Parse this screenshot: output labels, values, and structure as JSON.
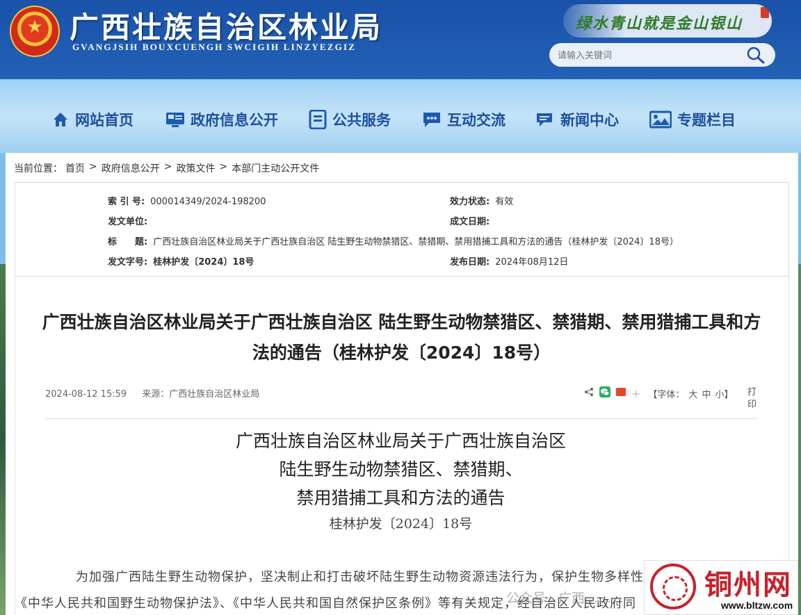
{
  "header": {
    "title": "广西壮族自治区林业局",
    "subtitle": "GVANGJSIH BOUXCUENGH SWCIGIH LINZYEZGIZ",
    "slogan": "绿水青山就是金山银山",
    "search_placeholder": "请输入关键词"
  },
  "nav": [
    {
      "label": "网站首页",
      "icon": "home-icon"
    },
    {
      "label": "政府信息公开",
      "icon": "monitor-icon"
    },
    {
      "label": "公共服务",
      "icon": "document-icon"
    },
    {
      "label": "互动交流",
      "icon": "chat-icon"
    },
    {
      "label": "新闻中心",
      "icon": "news-icon"
    },
    {
      "label": "专题栏目",
      "icon": "image-icon"
    }
  ],
  "breadcrumb": {
    "prefix": "当前位置：",
    "items": [
      "首页",
      "政府信息公开",
      "政策文件",
      "本部门主动公开文件"
    ]
  },
  "info": {
    "index_label": "索 引 号:",
    "index_value": "000014349/2024-198200",
    "status_label": "效力状态:",
    "status_value": "有效",
    "issuer_label": "发文单位:",
    "issuer_value": "",
    "created_label": "成文日期:",
    "created_value": "",
    "title_label": "标　　题:",
    "title_value": "广西壮族自治区林业局关于广西壮族自治区 陆生野生动物禁猎区、禁猎期、禁用猎捕工具和方法的通告（桂林护发〔2024〕18号）",
    "docno_label": "发文字号:",
    "docno_value": "桂林护发〔2024〕18号",
    "pubdate_label": "发布日期:",
    "pubdate_value": "2024年08月12日"
  },
  "article": {
    "title": "广西壮族自治区林业局关于广西壮族自治区 陆生野生动物禁猎区、禁猎期、禁用猎捕工具和方法的通告（桂林护发〔2024〕18号）",
    "datetime": "2024-08-12 15:59",
    "source": "来源：广西壮族自治区林业局",
    "font_label": "【字体：",
    "font_big": "大",
    "font_mid": "中",
    "font_small": "小】",
    "print": "打印",
    "doc_title_1": "广西壮族自治区林业局关于广西壮族自治区",
    "doc_title_2": "陆生野生动物禁猎区、禁猎期、",
    "doc_title_3": "禁用猎捕工具和方法的通告",
    "doc_num": "桂林护发〔2024〕18号",
    "body_1": "为加强广西陆生野生动物保护，坚决制止和打击破坏陆生野生动物资源违法行为，保护生物多样性，根据",
    "body_2": "《中华人民共和国野生动物保护法》、《中华人民共和国自然保护区条例》等有关规定，经自治区人民政府同"
  },
  "overlay": {
    "watermark": "公众号 · 广西……",
    "logo_text": "铜州网",
    "logo_url": "www.bltzw.com"
  },
  "colors": {
    "header_bg": "#2261b7",
    "nav_text": "#1d4fa0",
    "logo_red": "#c8202a"
  }
}
